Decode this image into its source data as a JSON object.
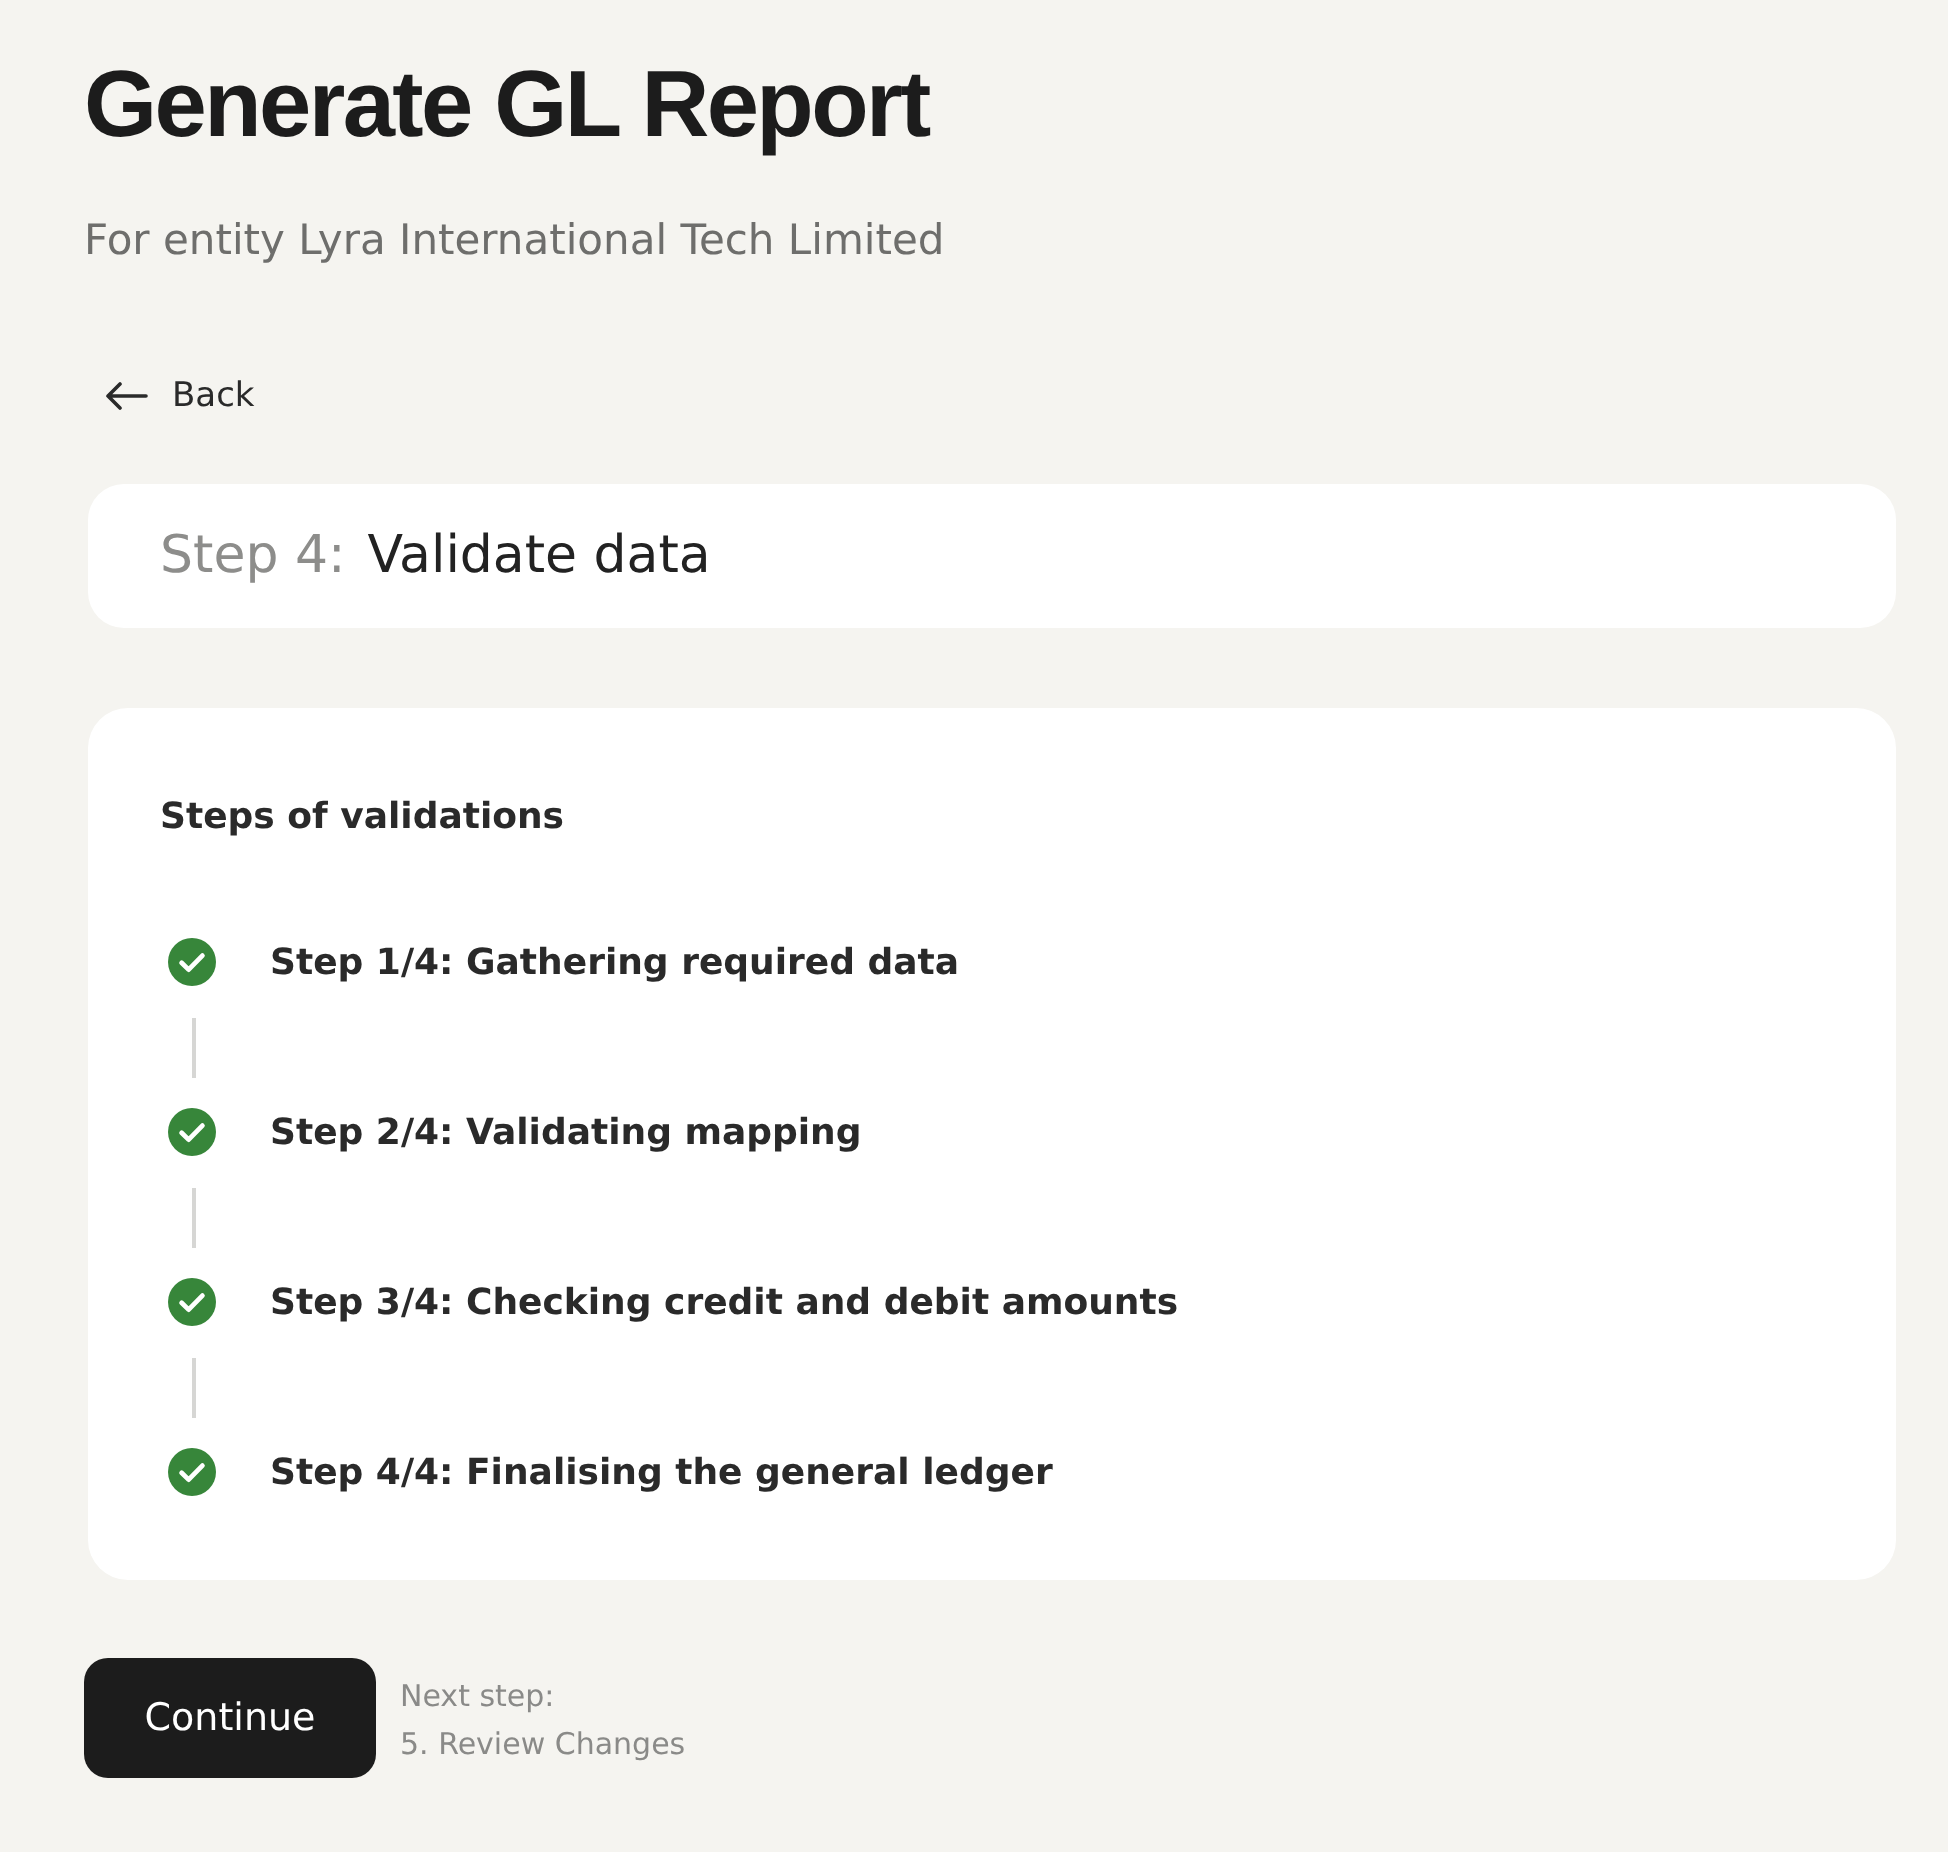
{
  "header": {
    "title": "Generate GL Report",
    "subtitle": "For entity Lyra International Tech Limited",
    "back_label": "Back"
  },
  "current_step": {
    "label": "Step 4:",
    "title": "Validate data"
  },
  "validation": {
    "heading": "Steps of validations",
    "steps": [
      {
        "label": "Step 1/4: Gathering required data",
        "completed": true
      },
      {
        "label": "Step 2/4: Validating mapping",
        "completed": true
      },
      {
        "label": "Step 3/4: Checking credit and debit amounts",
        "completed": true
      },
      {
        "label": "Step 4/4: Finalising the general ledger",
        "completed": true
      }
    ]
  },
  "footer": {
    "button": "Continue",
    "next_step_caption": "Next step:",
    "next_step_name": "5. Review Changes"
  }
}
